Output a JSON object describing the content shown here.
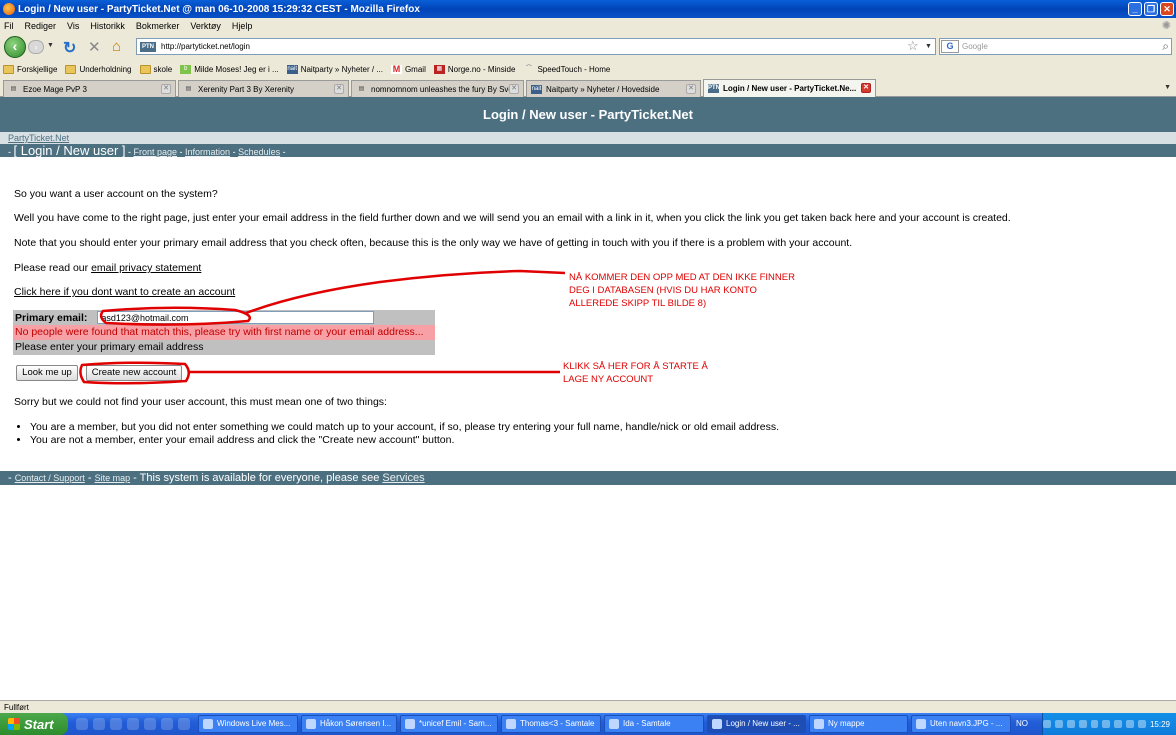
{
  "window": {
    "title": "Login / New user - PartyTicket.Net @ man 06-10-2008 15:29:32 CEST - Mozilla Firefox"
  },
  "menu": [
    "Fil",
    "Rediger",
    "Vis",
    "Historikk",
    "Bokmerker",
    "Verktøy",
    "Hjelp"
  ],
  "toolbar": {
    "url": "http://partyticket.net/login",
    "search_placeholder": "Google"
  },
  "bookmarks": [
    {
      "label": "Forskjellige",
      "icon": "folder-icon"
    },
    {
      "label": "Underholdning",
      "icon": "folder-icon"
    },
    {
      "label": "skole",
      "icon": "folder-icon"
    },
    {
      "label": "Milde Moses! Jeg er i ...",
      "icon": "bookmark-icon"
    },
    {
      "label": "Naitparty » Nyheter / ...",
      "icon": "naitparty-icon"
    },
    {
      "label": "Gmail",
      "icon": "gmail-icon"
    },
    {
      "label": "Norge.no - Minside",
      "icon": "norge-icon"
    },
    {
      "label": "SpeedTouch - Home",
      "icon": "speedtouch-icon"
    }
  ],
  "tabs": [
    {
      "label": "Ezoe Mage PvP 3"
    },
    {
      "label": "Xerenity Part 3 By Xerenity"
    },
    {
      "label": "nomnomnom unleashes the fury By Sve..."
    },
    {
      "label": "Naitparty » Nyheter / Hovedside"
    },
    {
      "label": "Login / New user - PartyTicket.Ne..."
    }
  ],
  "page": {
    "header": "Login / New user - PartyTicket.Net",
    "breadcrumb": "PartyTicket.Net",
    "nav": {
      "current": "[ Login / New user ]",
      "links": [
        "Front page",
        "Information",
        "Schedules"
      ]
    },
    "intro": "So you want a user account on the system?",
    "para1": "Well you have come to the right page, just enter your email address in the field further down and we will send you an email with a link in it, when you click the link you get taken back here and your account is created.",
    "para2": "Note that you should enter your primary email address that you check often, because this is the only way we have of getting in touch with you if there is a problem with your account.",
    "privacy_prefix": "Please read our",
    "privacy_link": "email privacy statement",
    "skip_link": "Click here if you dont want to create an account",
    "email_label": "Primary email:",
    "email_value": "asd123@hotmail.com",
    "error_message": "No people were found that match this, please try with first name or your email address...",
    "hint": "Please enter your primary email address",
    "lookup_button": "Look me up",
    "create_button": "Create new account",
    "not_found": "Sorry but we could not find your user account, this must mean one of two things:",
    "bullets": [
      "You are a member, but you did not enter something we could match up to your account, if so, please try entering your full name, handle/nick or old email address.",
      "You are not a member, enter your email address and click the \"Create new account\" button."
    ],
    "footer": {
      "contact": "Contact / Support",
      "sitemap": "Site map",
      "text": "This system is available for everyone, please see",
      "services": "Services"
    }
  },
  "annotations": {
    "note1": [
      "NÅ KOMMER DEN OPP MED AT DEN IKKE FINNER",
      "DEG I DATABASEN (HVIS DU HAR KONTO",
      "ALLEREDE SKIPP TIL BILDE 8)"
    ],
    "note2": [
      "KLIKK SÅ HER FOR Å STARTE Å",
      "LAGE NY ACCOUNT"
    ],
    "color": "#e00000"
  },
  "status": "Fullført",
  "taskbar": {
    "start": "Start",
    "tasks": [
      "Windows Live Mes...",
      "Håkon Sørensen I...",
      "*unicef Emil - Sam...",
      "Thomas<3 - Samtale",
      "Ida - Samtale",
      "Login / New user - ...",
      "Ny mappe",
      "Uten navn3.JPG - ..."
    ],
    "lang": "NO",
    "clock": "15:29"
  }
}
